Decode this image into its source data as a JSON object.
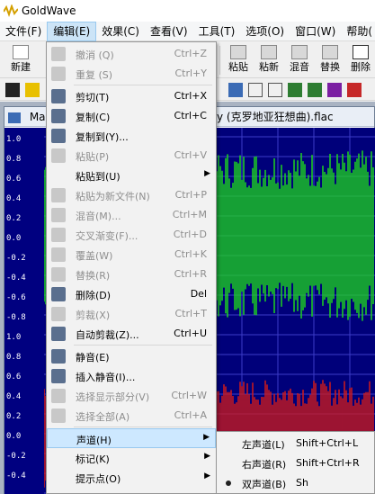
{
  "app": {
    "title": "GoldWave"
  },
  "menubar": [
    "文件(F)",
    "编辑(E)",
    "效果(C)",
    "查看(V)",
    "工具(T)",
    "选项(O)",
    "窗口(W)",
    "帮助("
  ],
  "toolbar": [
    "新建",
    "粘贴",
    "粘新",
    "混音",
    "替换",
    "删除"
  ],
  "document": {
    "title_left": "Ma",
    "title_right": "y (克罗地亚狂想曲).flac"
  },
  "scale_labels": [
    "1.0",
    "0.8",
    "0.6",
    "0.4",
    "0.2",
    "0.0",
    "-0.2",
    "-0.4",
    "-0.6",
    "-0.8",
    "1.0",
    "0.8",
    "0.6",
    "0.4",
    "0.2",
    "0.0",
    "-0.2",
    "-0.4"
  ],
  "edit_menu": [
    {
      "label": "撤消 (Q)",
      "shortcut": "Ctrl+Z",
      "disabled": true,
      "icon": "undo-icon"
    },
    {
      "label": "重复 (S)",
      "shortcut": "Ctrl+Y",
      "disabled": true,
      "icon": "redo-icon"
    },
    {
      "label": "剪切(T)",
      "shortcut": "Ctrl+X",
      "disabled": false,
      "icon": "cut-icon"
    },
    {
      "label": "复制(C)",
      "shortcut": "Ctrl+C",
      "disabled": false,
      "icon": "copy-icon"
    },
    {
      "label": "复制到(Y)...",
      "shortcut": "",
      "disabled": false,
      "icon": "copy-to-icon"
    },
    {
      "label": "粘贴(P)",
      "shortcut": "Ctrl+V",
      "disabled": true,
      "icon": "paste-icon"
    },
    {
      "label": "粘贴到(U)",
      "shortcut": "",
      "disabled": false,
      "icon": "",
      "submenu": true
    },
    {
      "label": "粘贴为新文件(N)",
      "shortcut": "Ctrl+P",
      "disabled": true,
      "icon": "paste-new-icon"
    },
    {
      "label": "混音(M)...",
      "shortcut": "Ctrl+M",
      "disabled": true,
      "icon": "mix-icon"
    },
    {
      "label": "交叉渐变(F)...",
      "shortcut": "Ctrl+D",
      "disabled": true,
      "icon": "crossfade-icon"
    },
    {
      "label": "覆盖(W)",
      "shortcut": "Ctrl+K",
      "disabled": true,
      "icon": "overwrite-icon"
    },
    {
      "label": "替换(R)",
      "shortcut": "Ctrl+R",
      "disabled": true,
      "icon": "replace-icon"
    },
    {
      "label": "删除(D)",
      "shortcut": "Del",
      "disabled": false,
      "icon": "delete-icon"
    },
    {
      "label": "剪裁(X)",
      "shortcut": "Ctrl+T",
      "disabled": true,
      "icon": "trim-icon"
    },
    {
      "label": "自动剪裁(Z)...",
      "shortcut": "Ctrl+U",
      "disabled": false,
      "icon": "auto-trim-icon"
    },
    {
      "label": "静音(E)",
      "shortcut": "",
      "disabled": false,
      "icon": "mute-icon"
    },
    {
      "label": "插入静音(I)...",
      "shortcut": "",
      "disabled": false,
      "icon": "insert-silence-icon"
    },
    {
      "label": "选择显示部分(V)",
      "shortcut": "Ctrl+W",
      "disabled": true,
      "icon": "select-view-icon"
    },
    {
      "label": "选择全部(A)",
      "shortcut": "Ctrl+A",
      "disabled": true,
      "icon": "select-all-icon"
    },
    {
      "label": "声道(H)",
      "shortcut": "",
      "disabled": false,
      "icon": "",
      "submenu": true,
      "highlighted": true
    },
    {
      "label": "标记(K)",
      "shortcut": "",
      "disabled": false,
      "icon": "",
      "submenu": true
    },
    {
      "label": "提示点(O)",
      "shortcut": "",
      "disabled": false,
      "icon": "",
      "submenu": true
    }
  ],
  "channel_submenu": [
    {
      "label": "左声道(L)",
      "shortcut": "Shift+Ctrl+L",
      "checked": false
    },
    {
      "label": "右声道(R)",
      "shortcut": "Shift+Ctrl+R",
      "checked": false
    },
    {
      "label": "双声道(B)",
      "shortcut": "Sh",
      "checked": true
    }
  ],
  "colors": {
    "waveform_top": "#1ed61e",
    "waveform_bottom": "#d11a1a",
    "wave_bg": "#00007a",
    "grid": "#3c3cc8",
    "menu_highlight": "#cde8ff",
    "menubar_active": "#cce4f7"
  }
}
